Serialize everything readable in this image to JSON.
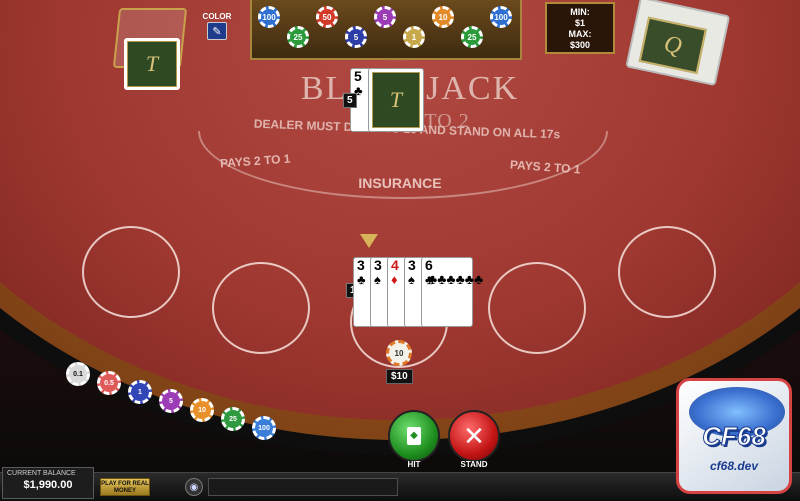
{
  "table": {
    "title": "BLACKJACK",
    "subtitle": "PAYS 3 TO 2",
    "dealer_rule": "DEALER MUST DRAW TO 16 AND STAND ON ALL 17s",
    "pays_left": "PAYS 2 TO 1",
    "pays_right": "PAYS 2 TO 1",
    "insurance": "INSURANCE",
    "card_back_letter": "T",
    "shoe_letter": "Q"
  },
  "color_button": {
    "label": "COLOR"
  },
  "limits": {
    "min_label": "MIN:",
    "min_value": "$1",
    "max_label": "MAX:",
    "max_value": "$300"
  },
  "rack_chips": [
    {
      "label": "100",
      "color": "#2f6fd1"
    },
    {
      "label": "25",
      "color": "#2a9a3a"
    },
    {
      "label": "50",
      "color": "#d33a2a"
    },
    {
      "label": "5",
      "color": "#2c3da8"
    },
    {
      "label": "5",
      "color": "#9b3bb5"
    },
    {
      "label": "1",
      "color": "#c7a84a"
    },
    {
      "label": "10",
      "color": "#e28a2a"
    },
    {
      "label": "25",
      "color": "#2a9a3a"
    },
    {
      "label": "100",
      "color": "#2f6fd1"
    }
  ],
  "dealer": {
    "card_rank": "5",
    "card_suit": "♣",
    "score": "5"
  },
  "player": {
    "cards": [
      {
        "rank": "3",
        "suit": "♣",
        "color": "#000000"
      },
      {
        "rank": "3",
        "suit": "♠",
        "color": "#000000"
      },
      {
        "rank": "4",
        "suit": "♦",
        "color": "#d01818"
      },
      {
        "rank": "3",
        "suit": "♠",
        "color": "#000000"
      },
      {
        "rank": "6",
        "suit": "♣",
        "color": "#000000"
      }
    ],
    "score": "19",
    "bet_chip": "10",
    "bet_amount": "$10"
  },
  "chip_tray": [
    {
      "label": "0.1",
      "color": "#d9d9d9"
    },
    {
      "label": "0.5",
      "color": "#e05a5a"
    },
    {
      "label": "1",
      "color": "#3346b8"
    },
    {
      "label": "5",
      "color": "#9b3bb5"
    },
    {
      "label": "10",
      "color": "#e8902a"
    },
    {
      "label": "25",
      "color": "#2f9a3f"
    },
    {
      "label": "100",
      "color": "#3a7ed9"
    }
  ],
  "actions": {
    "hit_label": "HIT",
    "stand_label": "STAND"
  },
  "bottom": {
    "balance_label": "CURRENT BALANCE",
    "balance_value": "$1,990.00",
    "real_money_label": "PLAY FOR REAL MONEY"
  },
  "watermark": {
    "brand": "CF68",
    "domain": "cf68.dev"
  }
}
